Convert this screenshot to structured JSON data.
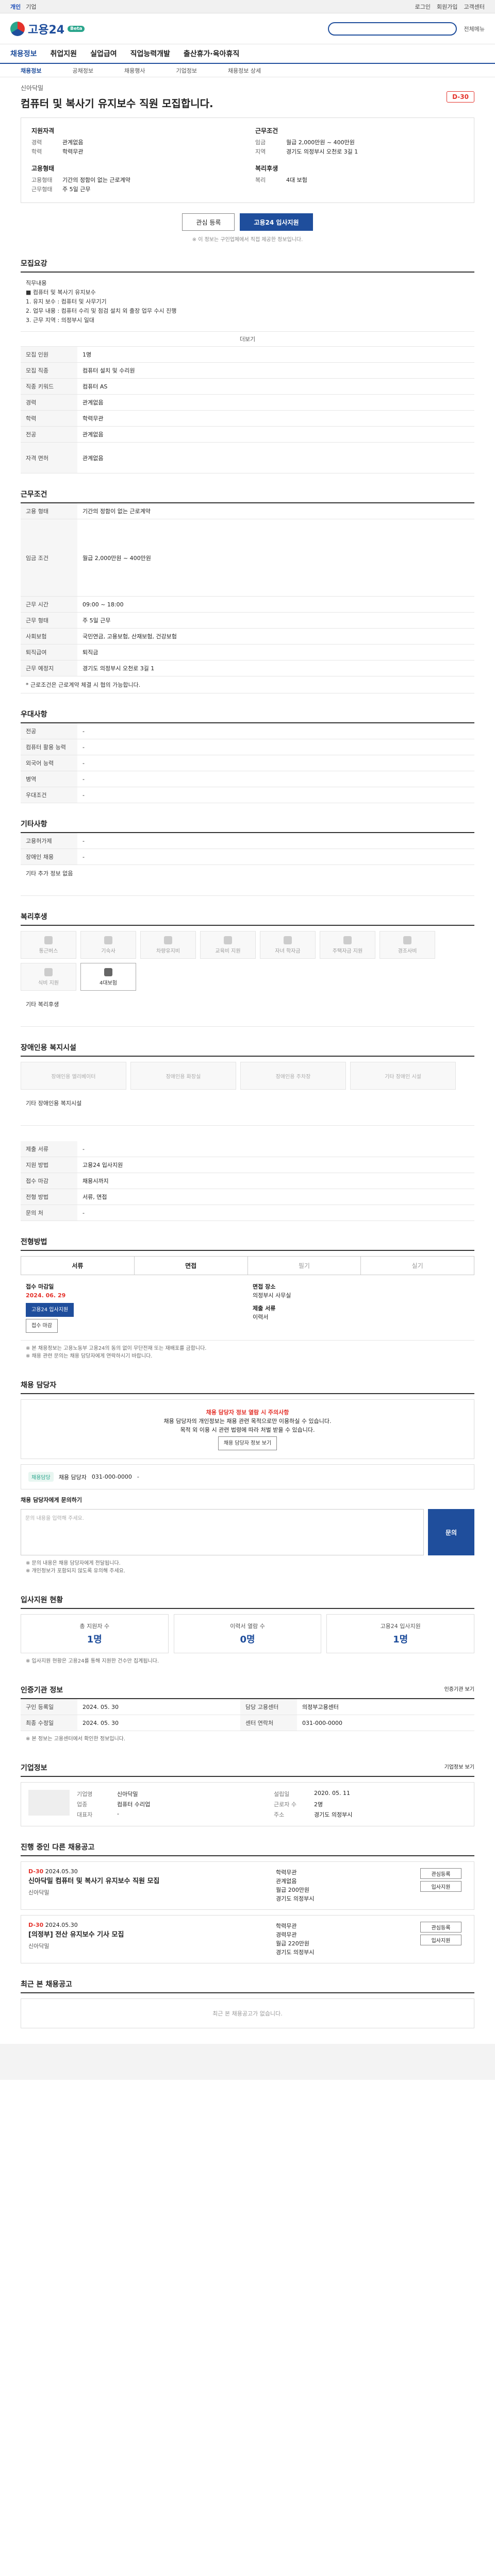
{
  "topbar": {
    "left": [
      "개인",
      "기업"
    ],
    "right": [
      "로그인",
      "회원가입",
      "고객센터"
    ]
  },
  "header": {
    "logo": "고용24",
    "badge": "Beta",
    "links": [
      "전체메뉴"
    ]
  },
  "gnb": [
    "채용정보",
    "취업지원",
    "실업급여",
    "직업능력개발",
    "출산휴가·육아휴직"
  ],
  "subnav": [
    "채용정보",
    "공채정보",
    "채용행사",
    "기업정보",
    "채용정보 상세"
  ],
  "job": {
    "company": "신아닥밀",
    "title": "컴퓨터 및 복사기 유지보수 직원 모집합니다.",
    "dday": "D-30"
  },
  "summary": {
    "left_title": "지원자격",
    "left": [
      [
        "경력",
        "관계없음"
      ],
      [
        "학력",
        "학력무관"
      ]
    ],
    "right_title": "근무조건",
    "right": [
      [
        "임금",
        "월급 2,000만원 ~ 400만원"
      ],
      [
        "지역",
        "경기도 의정부시 오천로 3길 1"
      ]
    ],
    "left2_title": "고용형태",
    "left2": [
      [
        "고용형태",
        "기간의 정함이 없는 근로계약"
      ],
      [
        "근무형태",
        "주 5일 근무"
      ]
    ],
    "right2_title": "복리후생",
    "right2": [
      [
        "복리",
        "4대 보험"
      ]
    ]
  },
  "buttons": {
    "interest": "관심 등록",
    "apply": "고용24 입사지원"
  },
  "notice": "※ 이 정보는 구인업체에서 직접 제공한 정보입니다.",
  "sections": {
    "recruit": "모집요강",
    "conditions": "근무조건",
    "prefer": "우대사항",
    "etc": "기타사항",
    "welfare": "복리후생",
    "disability": "장애인용 복지시설",
    "procedure": "전형방법",
    "manager": "채용 담당자",
    "applicants": "입사지원 현황",
    "agency": "인증기관 정보",
    "companyinfo": "기업정보",
    "others": "진행 중인 다른 채용공고",
    "recent": "최근 본 채용공고"
  },
  "recruit": {
    "desc": [
      "직무내용",
      "■ 컴퓨터 및 복사기 유지보수",
      "1. 유지 보수 : 컴퓨터 및 사무기기",
      "2. 업무 내용 : 컴퓨터 수리 및 점검 설치 외 출장 업무 수시 진행",
      "3. 근무 지역 : 의정부시 일대"
    ],
    "more": "더보기",
    "rows": [
      [
        "모집 인원",
        "1명"
      ],
      [
        "모집 직종",
        "컴퓨터 설치 및 수리원"
      ],
      [
        "직종 키워드",
        "컴퓨터 AS"
      ],
      [
        "경력",
        "관계없음"
      ],
      [
        "학력",
        "학력무관"
      ],
      [
        "전공",
        "관계없음"
      ],
      [
        "자격 면허",
        "관계없음"
      ]
    ]
  },
  "conditions": {
    "rows": [
      [
        "고용 형태",
        "기간의 정함이 없는 근로계약"
      ],
      [
        "임금 조건",
        "월급 2,000만원 ~ 400만원"
      ],
      [
        "근무 시간",
        "09:00 ~ 18:00"
      ],
      [
        "근무 형태",
        "주 5일 근무"
      ],
      [
        "사회보험",
        "국민연금, 고용보험, 산재보험, 건강보험"
      ],
      [
        "퇴직급여",
        "퇴직금"
      ],
      [
        "근무 예정지",
        "경기도 의정부시 오천로 3길 1"
      ]
    ],
    "note": "* 근로조건은 근로계약 체결 시 협의 가능합니다."
  },
  "prefer": {
    "rows": [
      [
        "전공",
        "-"
      ],
      [
        "컴퓨터 활용 능력",
        "-"
      ],
      [
        "외국어 능력",
        "-"
      ],
      [
        "병역",
        "-"
      ],
      [
        "우대조건",
        "-"
      ]
    ]
  },
  "etc": {
    "rows": [
      [
        "고용허가제",
        "-"
      ],
      [
        "장애인 채용",
        "-"
      ]
    ],
    "note": "기타 추가 정보 없음"
  },
  "welfare": {
    "items": [
      "통근버스",
      "기숙사",
      "차량유지비",
      "교육비 지원",
      "자녀 학자금",
      "주택자금 지원",
      "경조사비",
      "식비 지원",
      "4대보험"
    ],
    "active": "4대보험",
    "note": "기타 복리후생"
  },
  "disability": {
    "items": [
      "장애인용 엘리베이터",
      "장애인용 화장실",
      "장애인용 주차장",
      "기타 장애인 시설"
    ],
    "note": "기타 장애인용 복지시설"
  },
  "docs": {
    "rows": [
      [
        "제출 서류",
        "-"
      ],
      [
        "지원 방법",
        "고용24 입사지원"
      ],
      [
        "접수 마감",
        "채용시까지"
      ],
      [
        "전형 방법",
        "서류, 면접"
      ],
      [
        "문의 처",
        "-"
      ]
    ]
  },
  "procedure": {
    "tabs": [
      "서류",
      "면접",
      "필기",
      "실기"
    ],
    "on": [
      0,
      1
    ]
  },
  "period": {
    "left_lbl": "접수 마감일",
    "left_val": "2024. 06. 29",
    "left_btn": "고용24 입사지원",
    "left_btn2": "접수 마감",
    "right_lbl": "면접 장소",
    "right_val": "의정부시 사무실",
    "right_lbl2": "제출 서류",
    "right_val2": "이력서"
  },
  "period_notes": [
    "※ 본 채용정보는 고용노동부 고용24의 동의 없이 무단전재 또는 재배포를 금합니다.",
    "※ 채용 관련 문의는 채용 담당자에게 연락하시기 바랍니다."
  ],
  "manager": {
    "caution_title": "채용 담당자 정보 열람 시 주의사항",
    "caution_lines": [
      "채용 담당자의 개인정보는 채용 관련 목적으로만 이용하실 수 있습니다.",
      "목적 외 이용 시 관련 법령에 따라 처벌 받을 수 있습니다."
    ],
    "caution_btn": "채용 담당자 정보 보기",
    "badge": "채용담당",
    "name": "채용 담당자",
    "tel": "031-000-0000",
    "fax": "-"
  },
  "inquiry": {
    "title": "채용 담당자에게 문의하기",
    "placeholder": "문의 내용을 입력해 주세요.",
    "btn": "문의"
  },
  "inquiry_notes": [
    "※ 문의 내용은 채용 담당자에게 전달됩니다.",
    "※ 개인정보가 포함되지 않도록 유의해 주세요."
  ],
  "applicants": {
    "items": [
      [
        "총 지원자 수",
        "1명"
      ],
      [
        "이력서 열람 수",
        "0명"
      ],
      [
        "고용24 입사지원",
        "1명"
      ]
    ],
    "note": "※ 입사지원 현황은 고용24를 통해 지원한 건수만 집계됩니다."
  },
  "agency": {
    "btn": "인증기관 보기",
    "rows": [
      [
        "구인 등록일",
        "2024. 05. 30"
      ],
      [
        "최종 수정일",
        "2024. 05. 30"
      ],
      [
        "담당 고용센터",
        "의정부고용센터"
      ],
      [
        "센터 연락처",
        "031-000-0000"
      ]
    ],
    "note": "※ 본 정보는 고용센터에서 확인한 정보입니다."
  },
  "companyinfo": {
    "btn": "기업정보 보기",
    "rows": [
      [
        "기업명",
        "신아닥밀"
      ],
      [
        "업종",
        "컴퓨터 수리업"
      ],
      [
        "대표자",
        "-"
      ],
      [
        "설립일",
        "2020. 05. 11"
      ],
      [
        "근로자 수",
        "2명"
      ],
      [
        "주소",
        "경기도 의정부시"
      ]
    ]
  },
  "others": [
    {
      "dday": "D-30",
      "date": "2024.05.30",
      "title": "신아닥밀 컴퓨터 및 복사기 유지보수 직원 모집",
      "company": "신아닥밀",
      "info": [
        "학력무관",
        "관계없음",
        "월급 200만원",
        "경기도 의정부시"
      ],
      "btns": [
        "관심등록",
        "입사지원"
      ]
    },
    {
      "dday": "D-30",
      "date": "2024.05.30",
      "title": "[의정부] 전산 유지보수 기사 모집",
      "company": "신아닥밀",
      "info": [
        "학력무관",
        "경력무관",
        "월급 220만원",
        "경기도 의정부시"
      ],
      "btns": [
        "관심등록",
        "입사지원"
      ]
    }
  ],
  "recent": {
    "empty": "최근 본 채용공고가 없습니다."
  }
}
